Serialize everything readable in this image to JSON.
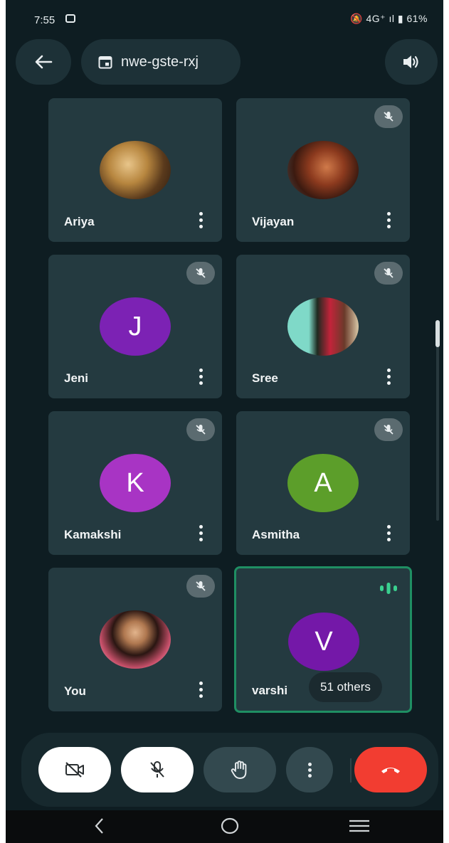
{
  "status_bar": {
    "time": "7:55",
    "indicators": "4G⁺ ıl",
    "battery": "61%"
  },
  "header": {
    "meeting_code": "nwe-gste-rxj"
  },
  "participants": [
    {
      "name": "Ariya",
      "avatar_type": "photo",
      "muted": false
    },
    {
      "name": "Vijayan",
      "avatar_type": "photo",
      "muted": true
    },
    {
      "name": "Jeni",
      "avatar_type": "initial",
      "initial": "J",
      "color": "#7c22b4",
      "muted": true
    },
    {
      "name": "Sree",
      "avatar_type": "photo",
      "muted": true
    },
    {
      "name": "Kamakshi",
      "avatar_type": "initial",
      "initial": "K",
      "color": "#a834c4",
      "muted": true
    },
    {
      "name": "Asmitha",
      "avatar_type": "initial",
      "initial": "A",
      "color": "#5c9e2a",
      "muted": true
    },
    {
      "name": "You",
      "avatar_type": "photo",
      "muted": true
    },
    {
      "name": "varshi",
      "avatar_type": "initial",
      "initial": "V",
      "color": "#7418a8",
      "muted": false,
      "speaking": true,
      "overflow_label": "51 others"
    }
  ],
  "controls": {
    "camera": "camera-off-icon",
    "mic": "mic-off-icon",
    "raise_hand": "hand-icon",
    "more": "more-vert-icon",
    "end_call": "end-call-icon"
  },
  "colors": {
    "background": "#0e1d22",
    "tile": "#243a40",
    "end_call": "#f23d31",
    "speaking": "#1f8f63"
  }
}
